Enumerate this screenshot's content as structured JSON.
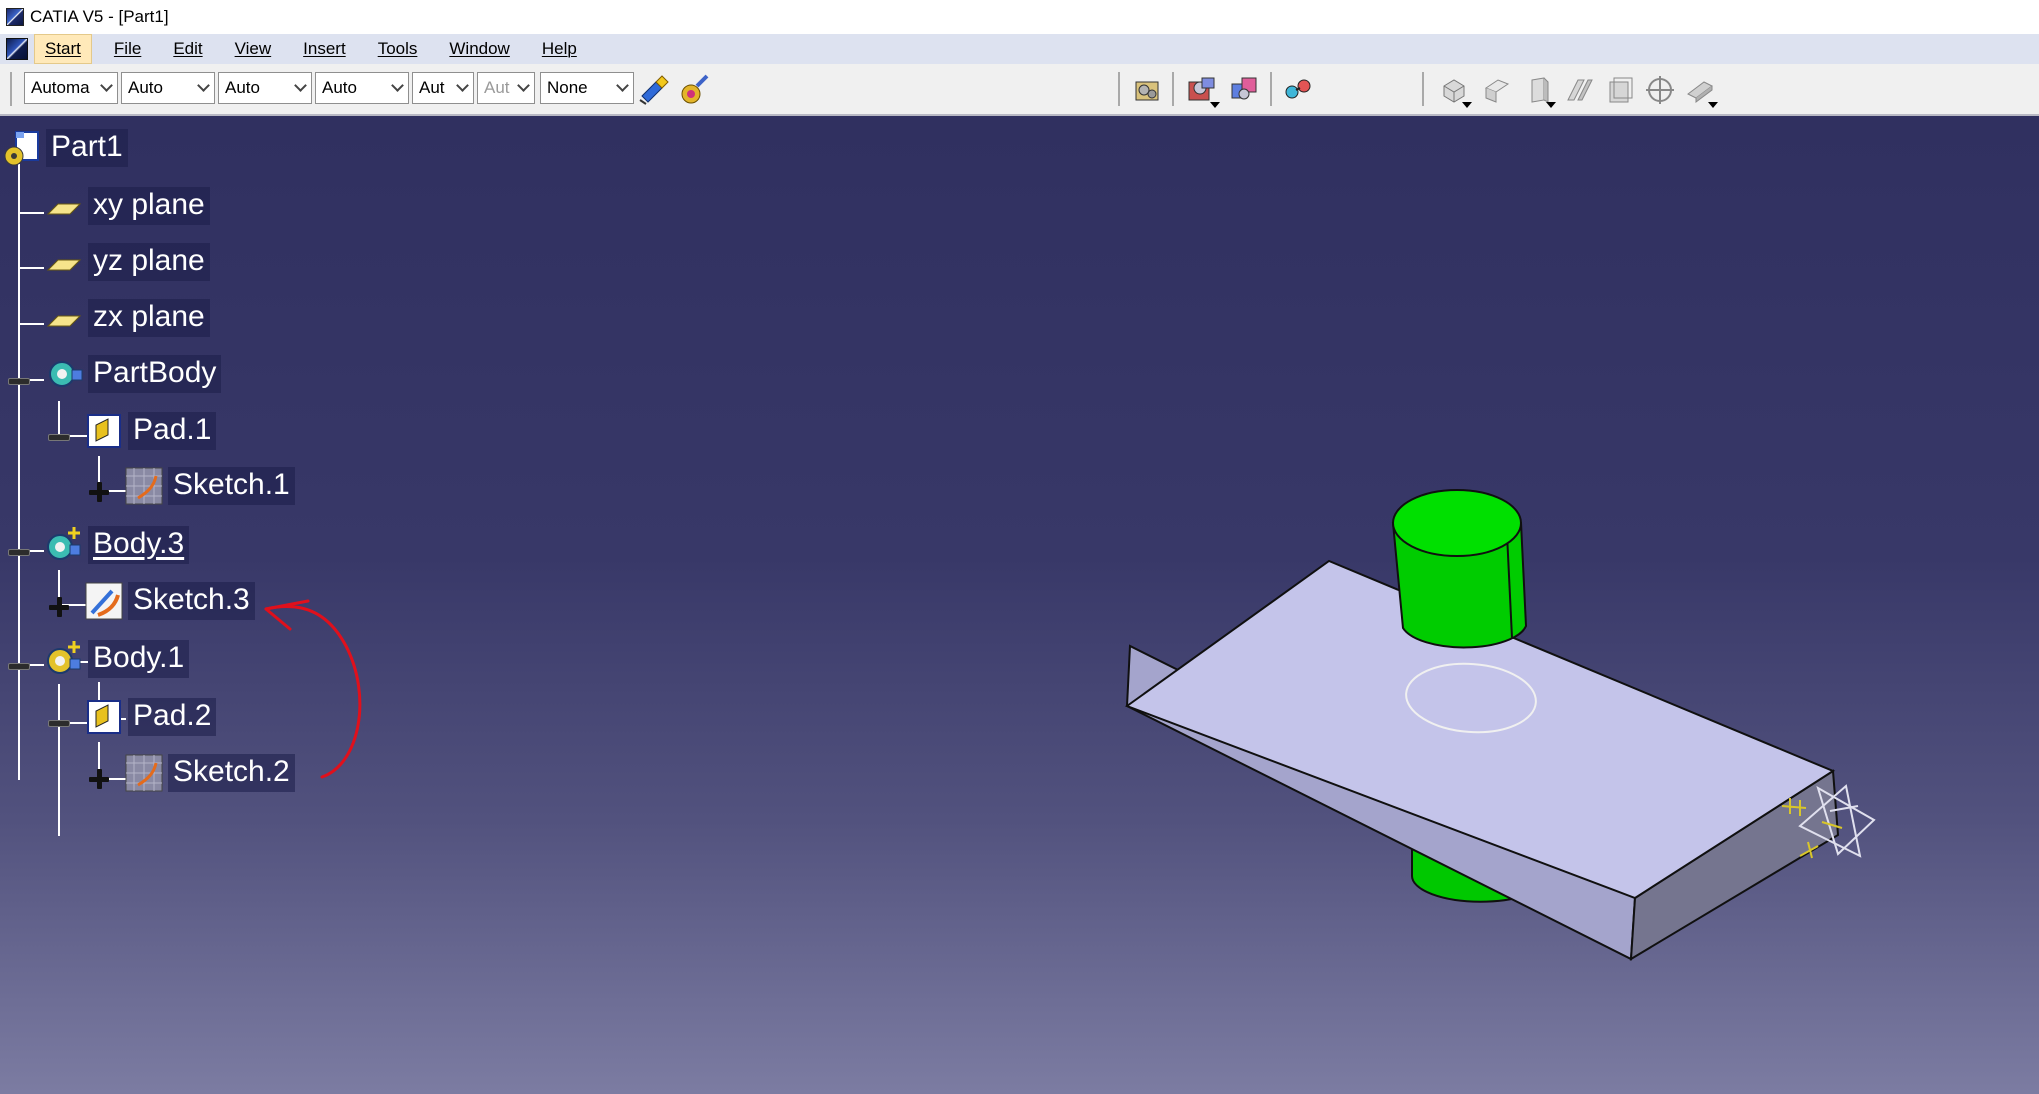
{
  "window": {
    "title": "CATIA V5 - [Part1]"
  },
  "menu": {
    "items": [
      {
        "label": "Start",
        "active": true
      },
      {
        "label": "File"
      },
      {
        "label": "Edit"
      },
      {
        "label": "View"
      },
      {
        "label": "Insert"
      },
      {
        "label": "Tools"
      },
      {
        "label": "Window"
      },
      {
        "label": "Help"
      }
    ]
  },
  "toolbar": {
    "graphic_properties": [
      {
        "name": "fill-color",
        "value": "Automa"
      },
      {
        "name": "transparency",
        "value": "Auto"
      },
      {
        "name": "line-thickness",
        "value": "Auto"
      },
      {
        "name": "line-type",
        "value": "Auto"
      },
      {
        "name": "point-type",
        "value": "Aut"
      },
      {
        "name": "rendering-style",
        "value": "Aut",
        "disabled": true
      },
      {
        "name": "layer",
        "value": "None"
      }
    ],
    "icons": [
      "painter-icon",
      "properties-brush-icon",
      "catalog-browser-icon",
      "apply-material-icon",
      "material-library-icon",
      "analyze-icon",
      "isometric-view-icon",
      "front-view-icon",
      "right-view-icon",
      "top-view-icon",
      "view-mode-icon",
      "named-views-icon",
      "shading-mode-icon"
    ]
  },
  "tree": {
    "root": "Part1",
    "planes": [
      "xy plane",
      "yz plane",
      "zx plane"
    ],
    "partbody": "PartBody",
    "pad1": "Pad.1",
    "sketch1": "Sketch.1",
    "body3": "Body.3",
    "sketch3": "Sketch.3",
    "body1": "Body.1",
    "pad2": "Pad.2",
    "sketch2": "Sketch.2"
  },
  "colors": {
    "viewport_top": "#303060",
    "viewport_bottom": "#7c7ca2",
    "block_top": "#c4c4ea",
    "cylinder": "#00d000",
    "annotation_arrow": "#e0101c",
    "compass": "#d8d8e8"
  }
}
